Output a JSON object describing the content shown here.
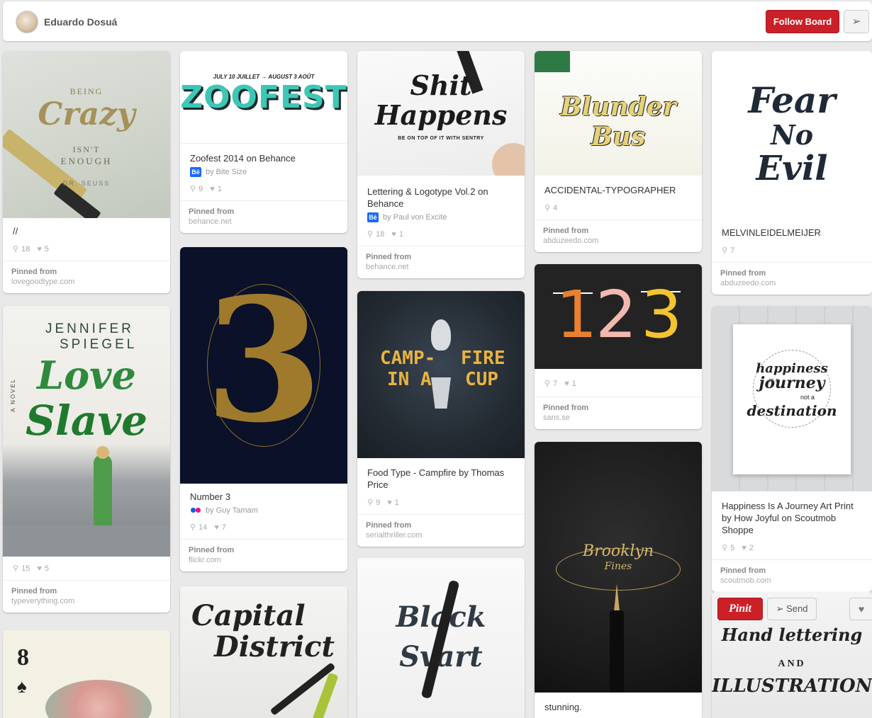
{
  "header": {
    "username": "Eduardo Dosuá",
    "follow_label": "Follow Board",
    "send_icon": "paper-plane"
  },
  "pins": [
    {
      "desc": "//",
      "repins": "18",
      "likes": "5",
      "pinned_from": "Pinned from",
      "domain": "lovegoodtype.com",
      "img": {
        "lines": [
          "BEING",
          "Crazy",
          "ISN'T",
          "ENOUGH",
          "DR. SEUSS"
        ]
      }
    },
    {
      "img": {
        "lines": [
          "JENNIFER",
          "SPIEGEL",
          "Love",
          "Slave",
          "A NOVEL"
        ]
      },
      "repins": "15",
      "likes": "5",
      "pinned_from": "Pinned from",
      "domain": "typeverything.com"
    },
    {
      "img": {
        "lines": [
          "8"
        ]
      }
    },
    {
      "desc": "Zoofest 2014 on Behance",
      "source_icon": "Bē",
      "source": "by Bite Size",
      "repins": "9",
      "likes": "1",
      "pinned_from": "Pinned from",
      "domain": "behance.net",
      "img": {
        "lines": [
          "JULY 10 JUILLET → AUGUST 3 AOÛT",
          "ZOOFEST"
        ]
      }
    },
    {
      "desc": "Number 3",
      "source": "by Guy Tamam",
      "repins": "14",
      "likes": "7",
      "pinned_from": "Pinned from",
      "domain": "flickr.com",
      "img": {
        "lines": [
          "3"
        ]
      }
    },
    {
      "img": {
        "lines": [
          "Capital",
          "District"
        ]
      }
    },
    {
      "desc": "Lettering & Logotype Vol.2 on Behance",
      "source_icon": "Bē",
      "source": "by Paul von Excite",
      "repins": "18",
      "likes": "1",
      "pinned_from": "Pinned from",
      "domain": "behance.net",
      "img": {
        "lines": [
          "Shit",
          "Happens",
          "BE ON TOP OF IT WITH SENTRY"
        ]
      }
    },
    {
      "desc": "Food Type - Campfire by Thomas Price",
      "repins": "9",
      "likes": "1",
      "pinned_from": "Pinned from",
      "domain": "serialthriller.com",
      "img": {
        "lines": [
          "CAMP-",
          "IN A",
          "FIRE",
          "CUP"
        ]
      }
    },
    {
      "img": {
        "lines": [
          "Black",
          "Svart"
        ]
      }
    },
    {
      "desc": "ACCIDENTAL-TYPOGRAPHER",
      "repins": "4",
      "pinned_from": "Pinned from",
      "domain": "abduzeedo.com",
      "img": {
        "lines": [
          "Blunder Bus"
        ]
      }
    },
    {
      "repins": "7",
      "likes": "1",
      "pinned_from": "Pinned from",
      "domain": "sans.se",
      "img": {
        "lines": [
          "1",
          "2",
          "3"
        ]
      }
    },
    {
      "desc": "stunning.",
      "img": {
        "lines": [
          "Brooklyn",
          "Fines"
        ]
      }
    },
    {
      "desc": "MELVINLEIDELMEIJER",
      "repins": "7",
      "pinned_from": "Pinned from",
      "domain": "abduzeedo.com",
      "img": {
        "lines": [
          "Fear",
          "No",
          "Evil"
        ]
      }
    },
    {
      "desc": "Happiness Is A Journey Art Print by How Joyful on Scoutmob Shoppe",
      "repins": "5",
      "likes": "2",
      "pinned_from": "Pinned from",
      "domain": "scoutmob.com",
      "img": {
        "lines": [
          "happiness",
          "is a",
          "journey",
          "not a",
          "destination"
        ]
      }
    },
    {
      "img": {
        "lines": [
          "Hand lettering",
          "AND",
          "ILLUSTRATION"
        ]
      },
      "pinit_label": "Pinit",
      "send_label": "Send"
    }
  ],
  "colors": {
    "brand_red": "#cb2027",
    "bg": "#e9e9e9"
  }
}
